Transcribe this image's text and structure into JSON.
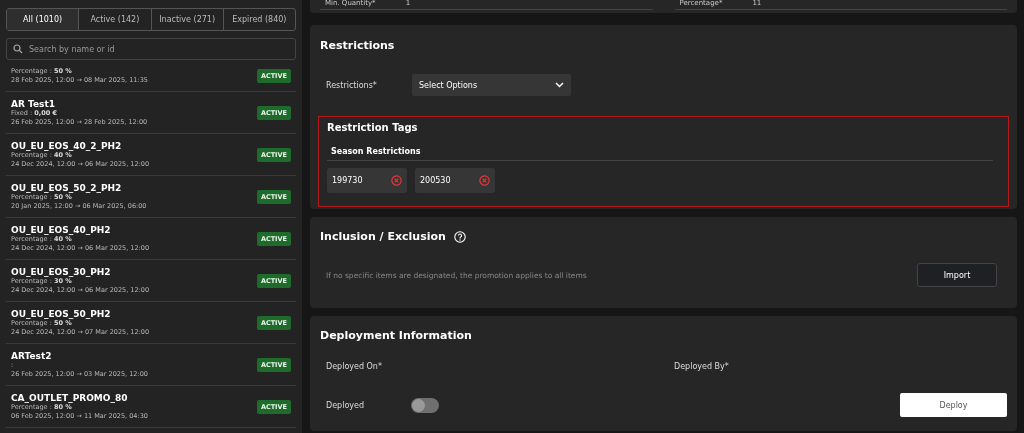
{
  "filter_tabs": [
    {
      "label": "All (1010)",
      "selected": true
    },
    {
      "label": "Active (142)",
      "selected": false
    },
    {
      "label": "Inactive (271)",
      "selected": false
    },
    {
      "label": "Expired (840)",
      "selected": false
    }
  ],
  "search": {
    "placeholder": "Search by name or id"
  },
  "promotions": [
    {
      "detail": "Percentage : **50 %**",
      "dates": "28 Feb 2025, 12:00 → 08 Mar 2025, 11:35",
      "status": "ACTIVE"
    },
    {
      "name": "AR Test1",
      "detail": "Fixed : **0,00 €**",
      "dates": "26 Feb 2025, 12:00 → 28 Feb 2025, 12:00",
      "status": "ACTIVE"
    },
    {
      "name": "OU_EU_EOS_40_2_PH2",
      "detail": "Percentage : **40 %**",
      "dates": "24 Dec 2024, 12:00 → 06 Mar 2025, 12:00",
      "status": "ACTIVE"
    },
    {
      "name": "OU_EU_EOS_50_2_PH2",
      "detail": "Percentage : **50 %**",
      "dates": "20 Jan 2025, 12:00 → 06 Mar 2025, 06:00",
      "status": "ACTIVE"
    },
    {
      "name": "OU_EU_EOS_40_PH2",
      "detail": "Percentage : **40 %**",
      "dates": "24 Dec 2024, 12:00 → 06 Mar 2025, 12:00",
      "status": "ACTIVE"
    },
    {
      "name": "OU_EU_EOS_30_PH2",
      "detail": "Percentage : **30 %**",
      "dates": "24 Dec 2024, 12:00 → 06 Mar 2025, 12:00",
      "status": "ACTIVE"
    },
    {
      "name": "OU_EU_EOS_50_PH2",
      "detail": "Percentage : **50 %**",
      "dates": "24 Dec 2024, 12:00 → 07 Mar 2025, 12:00",
      "status": "ACTIVE"
    },
    {
      "name": "ARTest2",
      "detail": ":",
      "dates": "26 Feb 2025, 12:00 → 03 Mar 2025, 12:00",
      "status": "ACTIVE"
    },
    {
      "name": "CA_OUTLET_PROMO_80",
      "detail": "Percentage : **80 %**",
      "dates": "06 Feb 2025, 12:00 → 11 Mar 2025, 04:30",
      "status": "ACTIVE"
    }
  ],
  "conditions": [
    {
      "label": "Min. Quantity*",
      "value": "1"
    },
    {
      "label": "Percentage*",
      "value": "11"
    }
  ],
  "restrictions": {
    "title": "Restrictions",
    "label": "Restrictions*",
    "select": "Select Options",
    "tags_title": "Restriction Tags",
    "group": "Season Restrictions",
    "tags": [
      "199730",
      "200530"
    ]
  },
  "inclusion": {
    "title": "Inclusion / Exclusion",
    "note": "If no specific items are designated, the promotion applies to all items",
    "button": "Import"
  },
  "deployment": {
    "title": "Deployment Information",
    "deployed_on": "Deployed On*",
    "deployed_by": "Deployed By*",
    "toggle_label": "Deployed",
    "deployed": false,
    "button": "Deploy"
  }
}
